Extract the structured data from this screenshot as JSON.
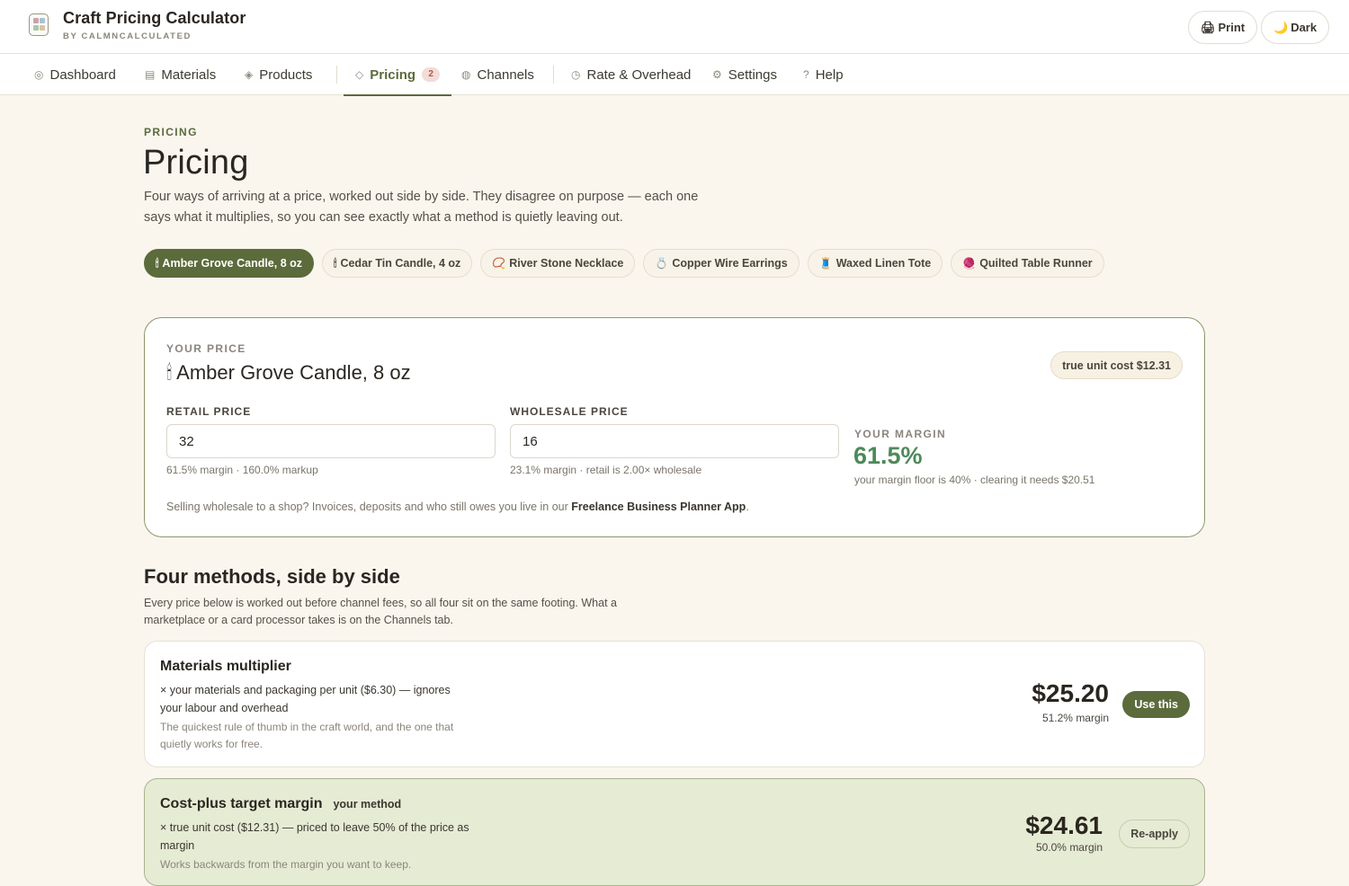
{
  "app": {
    "title": "Craft Pricing Calculator",
    "subtitle": "BY CALMNCALCULATED",
    "print_label": "Print",
    "dark_label": "Dark",
    "print_icon": "🖨",
    "dark_icon": "🌙"
  },
  "tabs": [
    {
      "label": "Dashboard",
      "icon": "◎"
    },
    {
      "label": "Materials",
      "icon": "▤"
    },
    {
      "label": "Products",
      "icon": "◈"
    },
    {
      "label": "Pricing",
      "icon": "◇",
      "badge": "2"
    },
    {
      "label": "Channels",
      "icon": "◍"
    },
    {
      "label": "Rate & Overhead",
      "icon": "◷"
    },
    {
      "label": "Settings",
      "icon": "⚙"
    },
    {
      "label": "Help",
      "icon": "?"
    }
  ],
  "page": {
    "eyebrow": "PRICING",
    "title": "Pricing",
    "intro": "Four ways of arriving at a price, worked out side by side. They disagree on purpose — each one says what it multiplies, so you can see exactly what a method is quietly leaving out."
  },
  "products": [
    {
      "emoji": "🕯",
      "name": "Amber Grove Candle, 8 oz"
    },
    {
      "emoji": "🕯",
      "name": "Cedar Tin Candle, 4 oz"
    },
    {
      "emoji": "📿",
      "name": "River Stone Necklace"
    },
    {
      "emoji": "💍",
      "name": "Copper Wire Earrings"
    },
    {
      "emoji": "🧵",
      "name": "Waxed Linen Tote"
    },
    {
      "emoji": "🧶",
      "name": "Quilted Table Runner"
    }
  ],
  "price_card": {
    "eyebrow": "YOUR PRICE",
    "emoji": "🕯",
    "product_name": "Amber Grove Candle, 8 oz",
    "cost_pill": "true unit cost $12.31",
    "retail_label": "RETAIL PRICE",
    "retail_value": "32",
    "retail_hint": "61.5% margin · 160.0% markup",
    "wholesale_label": "WHOLESALE PRICE",
    "wholesale_value": "16",
    "wholesale_hint": "23.1% margin · retail is 2.00× wholesale",
    "margin_label": "YOUR MARGIN",
    "margin_value": "61.5%",
    "margin_note": "your margin floor is 40% · clearing it needs $20.51",
    "footer_text": "Selling wholesale to a shop? Invoices, deposits and who still owes you live in our ",
    "footer_link": "Freelance Business Planner App",
    "footer_end": "."
  },
  "methods_section": {
    "title": "Four methods, side by side",
    "desc": "Every price below is worked out before channel fees, so all four sit on the same footing. What a marketplace or a card processor takes is on the Channels tab."
  },
  "methods": [
    {
      "title": "Materials multiplier",
      "tag": "",
      "formula": "× your materials and packaging per unit ($6.30) — ignores your labour and overhead",
      "note": "The quickest rule of thumb in the craft world, and the one that quietly works for free.",
      "price": "$25.20",
      "margin": "51.2% margin",
      "action": "Use this"
    },
    {
      "title": "Cost-plus target margin",
      "tag": "your method",
      "formula": "× true unit cost ($12.31) — priced to leave 50% of the price as margin",
      "note": "Works backwards from the margin you want to keep.",
      "price": "$24.61",
      "margin": "50.0% margin",
      "action": "Re-apply"
    }
  ],
  "colors": {
    "accent": "#5c6b3b",
    "margin_good": "#4e8a5a",
    "background": "#faf6ee",
    "badge_bg": "#f2dcd7"
  }
}
